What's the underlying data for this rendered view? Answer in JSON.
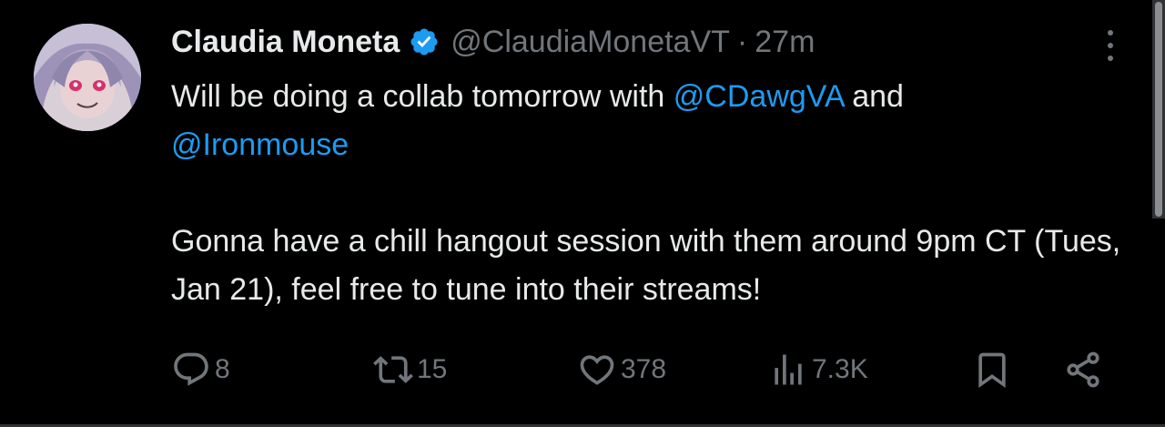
{
  "tweet": {
    "author_name": "Claudia Moneta",
    "author_handle": "@ClaudiaMonetaVT",
    "separator": "·",
    "time_ago": "27m",
    "verified": true,
    "body": {
      "line1_text": "Will be doing a collab tomorrow with ",
      "mention1": "@CDawgVA",
      "line1_and": " and",
      "mention2": "@Ironmouse",
      "paragraph2": "Gonna have a chill hangout session with them around 9pm CT (Tues, Jan 21), feel free to tune into their streams!"
    },
    "actions": {
      "replies": "8",
      "reposts": "15",
      "likes": "378",
      "views": "7.3K"
    }
  },
  "icons": {
    "verified": "verified-badge-icon",
    "more": "more-vertical-icon",
    "reply": "reply-bubble-icon",
    "repost": "repost-icon",
    "like": "heart-icon",
    "views": "bar-chart-icon",
    "bookmark": "bookmark-icon",
    "share": "share-icon"
  },
  "colors": {
    "background": "#000000",
    "text_primary": "#e7e9ea",
    "text_secondary": "#71767b",
    "link": "#1d9bf0",
    "verified": "#1d9bf0"
  }
}
